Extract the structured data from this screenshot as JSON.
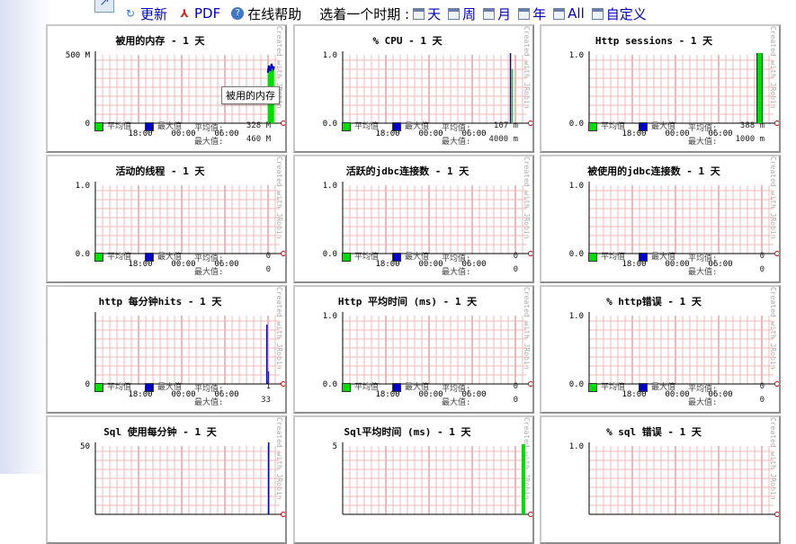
{
  "toolbar": {
    "refresh": "更新",
    "pdf": "PDF",
    "help": "在线帮助",
    "period_label": "选着一个时期 :",
    "periods": [
      "天",
      "周",
      "月",
      "年",
      "All",
      "自定义"
    ]
  },
  "tooltip": "被用的内存",
  "credit": "Created with JRobin",
  "legend": {
    "avg": "平均值",
    "max": "最大值"
  },
  "stat_labels": {
    "avg": "平均值:",
    "max": "最大值:"
  },
  "colors": {
    "avg": "#00dd00",
    "max": "#0000cc",
    "grid": "#f0b8b8",
    "axis": "#000000"
  },
  "panels": [
    {
      "title": "被用的内存 - 1 天",
      "ytop": "500 M",
      "ybot": "0",
      "xticks": [
        "18:00",
        "00:00",
        "06:00"
      ],
      "avg": "328 M",
      "max": "460 M",
      "spike": {
        "type": "mem",
        "pos": 0.95
      }
    },
    {
      "title": "% CPU - 1 天",
      "ytop": "1.0",
      "ybot": "0.0",
      "xticks": [
        "18:00",
        "00:00",
        "06:00"
      ],
      "avg": "107 m",
      "max": "4000 m",
      "spike": {
        "type": "cpu",
        "pos": 0.91
      }
    },
    {
      "title": "Http sessions - 1 天",
      "ytop": "1.0",
      "ybot": "0.0",
      "xticks": [
        "18:00",
        "00:00",
        "06:00"
      ],
      "avg": "388 m",
      "max": "1000 m",
      "spike": {
        "type": "sess",
        "pos": 0.92
      }
    },
    {
      "title": "活动的线程 - 1 天",
      "ytop": "1.0",
      "ybot": "0.0",
      "xticks": [
        "18:00",
        "00:00",
        "06:00"
      ],
      "avg": "0",
      "max": "0",
      "spike": null
    },
    {
      "title": "活跃的jdbc连接数 - 1 天",
      "ytop": "1.0",
      "ybot": "0.0",
      "xticks": [
        "18:00",
        "00:00",
        "06:00"
      ],
      "avg": "0",
      "max": "0",
      "spike": null
    },
    {
      "title": "被使用的jdbc连接数 - 1 天",
      "ytop": "1.0",
      "ybot": "0.0",
      "xticks": [
        "18:00",
        "00:00",
        "06:00"
      ],
      "avg": "0",
      "max": "0",
      "spike": null
    },
    {
      "title": "http 每分钟hits - 1 天",
      "ytop": "",
      "ybot": "0",
      "xticks": [
        "18:00",
        "00:00",
        "06:00"
      ],
      "avg": "1",
      "max": "33",
      "spike": {
        "type": "hits",
        "pos": 0.93
      }
    },
    {
      "title": "Http 平均时间 (ms) - 1 天",
      "ytop": "1.0",
      "ybot": "0.0",
      "xticks": [
        "18:00",
        "00:00",
        "06:00"
      ],
      "avg": "0",
      "max": "0",
      "spike": null
    },
    {
      "title": "% http错误 - 1 天",
      "ytop": "1.0",
      "ybot": "0.0",
      "xticks": [
        "18:00",
        "00:00",
        "06:00"
      ],
      "avg": "0",
      "max": "0",
      "spike": null
    },
    {
      "title": "Sql 使用每分钟 - 1 天",
      "ytop": "50",
      "ybot": "",
      "xticks": [],
      "avg": "",
      "max": "",
      "spike": {
        "type": "sqlm",
        "pos": 0.94
      }
    },
    {
      "title": "Sql平均时间 (ms) - 1 天",
      "ytop": "5",
      "ybot": "",
      "xticks": [],
      "avg": "",
      "max": "",
      "spike": {
        "type": "sqlt",
        "pos": 0.98
      }
    },
    {
      "title": "% sql 错误 - 1 天",
      "ytop": "1.0",
      "ybot": "",
      "xticks": [],
      "avg": "",
      "max": "",
      "spike": null
    }
  ]
}
